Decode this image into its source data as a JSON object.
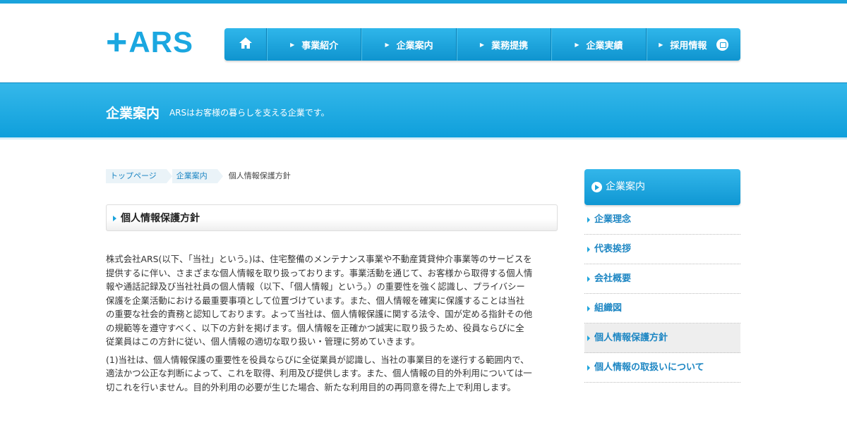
{
  "logo": {
    "plus": "+",
    "text": "ARS"
  },
  "nav": {
    "home_icon": "home-icon",
    "items": [
      {
        "label": "事業紹介"
      },
      {
        "label": "企業案内"
      },
      {
        "label": "業務提携"
      },
      {
        "label": "企業実績"
      },
      {
        "label": "採用情報",
        "icon": "external-link-icon"
      }
    ]
  },
  "hero": {
    "title": "企業案内",
    "subtitle": "ARSはお客様の暮らしを支える企業です。"
  },
  "breadcrumb": [
    "トップページ",
    "企業案内",
    "個人情報保護方針"
  ],
  "section_title": "個人情報保護方針",
  "body": {
    "paragraphs": [
      "株式会社ARS(以下、「当社」という。)は、住宅整備のメンテナンス事業や不動産賃貸仲介事業等のサービスを提供するに伴い、さまざまな個人情報を取り扱っております。事業活動を通じて、お客様から取得する個人情報や通話記録及び当社社員の個人情報（以下、「個人情報」という。）の重要性を強く認識し、プライバシー保護を企業活動における最重要事項として位置づけています。また、個人情報を確実に保護することは当社の重要な社会的責務と認知しております。よって当社は、個人情報保護に関する法令、国が定める指針その他の規範等を遵守すべく、以下の方針を掲げます。個人情報を正確かつ誠実に取り扱うため、役員ならびに全従業員はこの方針に従い、個人情報の適切な取り扱い・管理に努めていきます。",
      "(1)当社は、個人情報保護の重要性を役員ならびに全従業員が認識し、当社の事業目的を遂行する範囲内で、適法かつ公正な判断によって、これを取得、利用及び提供します。また、個人情報の目的外利用については一切これを行いません。目的外利用の必要が生じた場合、新たな利用目的の再同意を得た上で利用します。"
    ]
  },
  "sidebar": {
    "heading": "企業案内",
    "items": [
      {
        "label": "企業理念"
      },
      {
        "label": "代表挨拶"
      },
      {
        "label": "会社概要"
      },
      {
        "label": "組織図"
      },
      {
        "label": "個人情報保護方針",
        "active": true
      },
      {
        "label": "個人情報の取扱いについて"
      }
    ]
  },
  "colors": {
    "accent": "#1aa3dc",
    "link": "#1d86c3"
  }
}
